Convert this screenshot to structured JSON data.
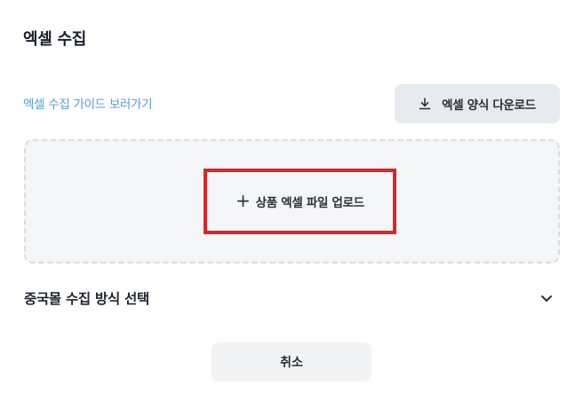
{
  "page": {
    "title": "엑셀 수집"
  },
  "guide": {
    "link_label": "엑셀 수집 가이드 보러가기"
  },
  "download": {
    "label": "엑셀 양식 다운로드",
    "icon": "download-icon"
  },
  "upload": {
    "plus": "+",
    "label": "상품 엑셀 파일 업로드",
    "highlight_color": "#e02424"
  },
  "section": {
    "label": "중국몰 수집 방식 선택",
    "icon": "chevron-down-icon"
  },
  "footer": {
    "cancel_label": "취소"
  },
  "colors": {
    "link": "#4f9fdc",
    "button_bg": "#e7eaee",
    "dropzone_bg": "#f4f6f8"
  }
}
